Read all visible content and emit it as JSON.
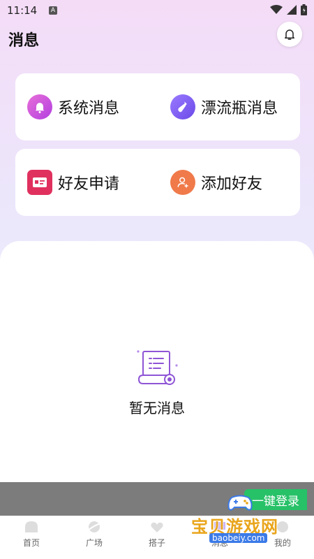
{
  "status_bar": {
    "time": "11:14",
    "notification_badge": "A"
  },
  "header": {
    "title": "消息"
  },
  "cards": [
    {
      "items": [
        {
          "label": "系统消息",
          "icon": "bell-icon",
          "color": "#c54be5"
        },
        {
          "label": "漂流瓶消息",
          "icon": "bottle-icon",
          "color": "#7a5cf0"
        }
      ]
    },
    {
      "items": [
        {
          "label": "好友申请",
          "icon": "id-card-icon",
          "color": "#e0315e"
        },
        {
          "label": "添加好友",
          "icon": "add-user-icon",
          "color": "#f07a4a"
        }
      ]
    }
  ],
  "empty_state": {
    "text": "暂无消息"
  },
  "login_banner": {
    "label": "一键登录"
  },
  "tabs": [
    {
      "label": "首页",
      "icon": "home-icon"
    },
    {
      "label": "广场",
      "icon": "planet-icon"
    },
    {
      "label": "搭子",
      "icon": "partner-icon"
    },
    {
      "label": "消息",
      "icon": "message-icon"
    },
    {
      "label": "我的",
      "icon": "profile-icon"
    }
  ],
  "watermark": {
    "text": "宝贝游戏网",
    "url": "baobeiy.com"
  }
}
